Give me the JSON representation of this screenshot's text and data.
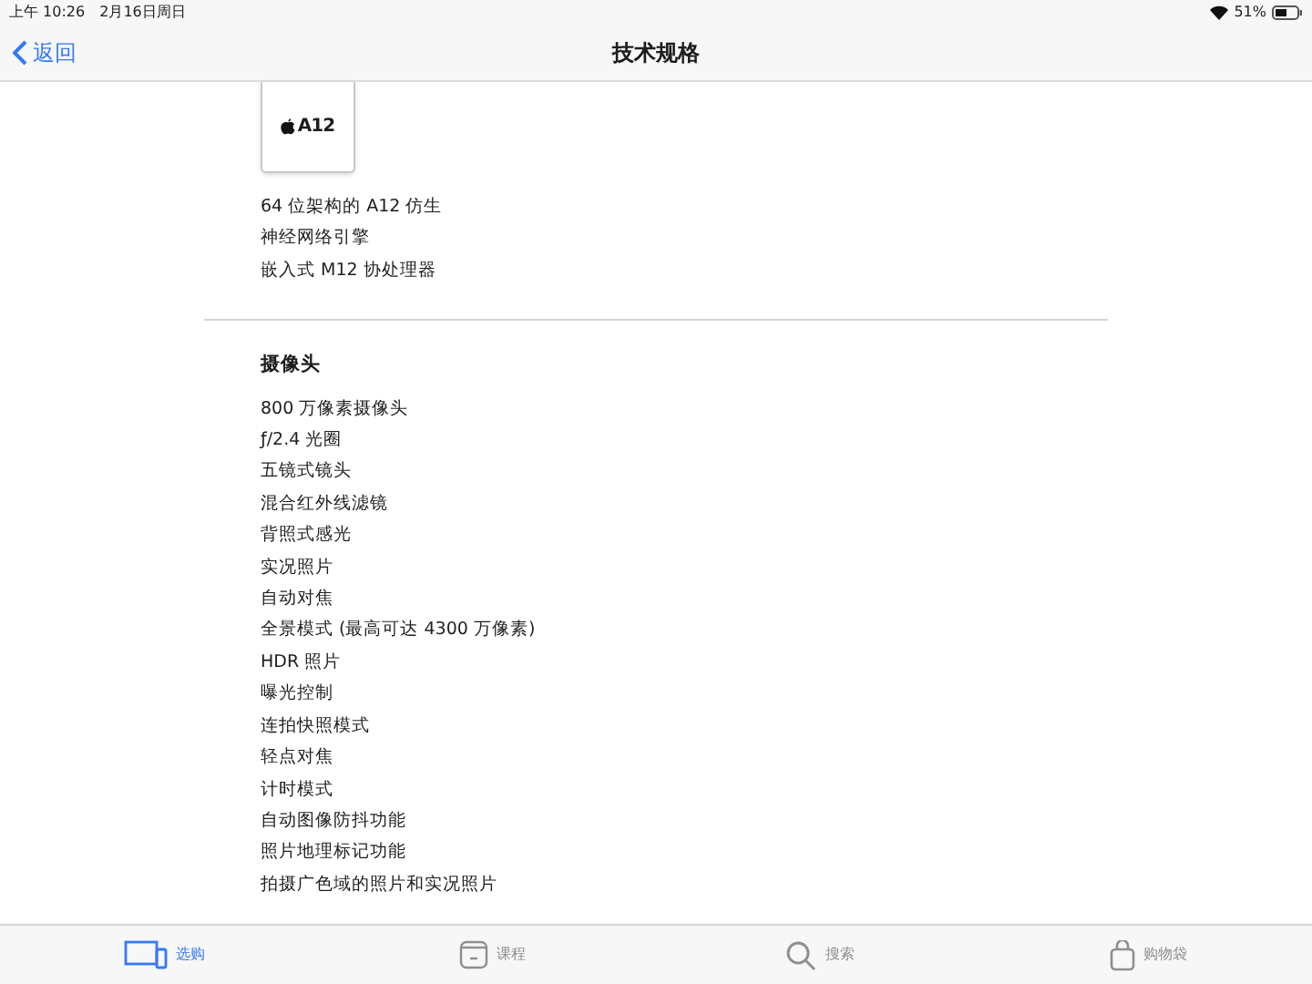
{
  "status_bar": {
    "time": "上午 10:26",
    "date": "2月16日周日",
    "battery": "51%"
  },
  "nav": {
    "back": "返回",
    "title": "技术规格"
  },
  "chip": {
    "label": "A12"
  },
  "chip_features": [
    "64 位架构的 A12 仿生",
    "神经网络引擎",
    "嵌入式 M12 协处理器"
  ],
  "camera": {
    "heading": "摄像头",
    "items": [
      "800 万像素摄像头",
      "ƒ/2.4 光圈",
      "五镜式镜头",
      "混合红外线滤镜",
      "背照式感光",
      "实况照片",
      "自动对焦",
      "全景模式 (最高可达 4300 万像素)",
      "HDR 照片",
      "曝光控制",
      "连拍快照模式",
      "轻点对焦",
      "计时模式",
      "自动图像防抖功能",
      "照片地理标记功能",
      "拍摄广色域的照片和实况照片"
    ]
  },
  "tab_bar": [
    {
      "label": "选购",
      "kind": "shop",
      "selected": true
    },
    {
      "label": "课程",
      "kind": "sessions",
      "selected": false
    },
    {
      "label": "搜索",
      "kind": "search",
      "selected": false
    },
    {
      "label": "购物袋",
      "kind": "bag",
      "selected": false
    }
  ]
}
